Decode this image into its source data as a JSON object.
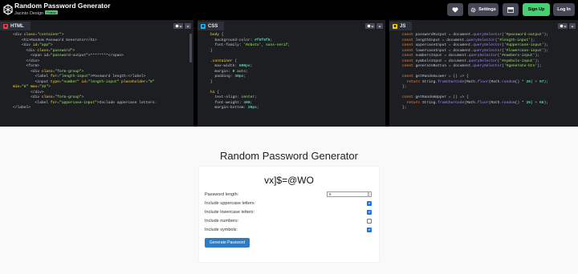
{
  "header": {
    "title": "Random Password Generator",
    "author": "Jacinto Design",
    "author_badge": "Follow",
    "settings_label": "Settings",
    "signup_label": "Sign Up",
    "login_label": "Log In"
  },
  "panels": {
    "html": {
      "label": "HTML"
    },
    "css": {
      "label": "CSS"
    },
    "js": {
      "label": "JS"
    }
  },
  "colors": {
    "accent_green": "#47cf73",
    "html_icon": "#ff3c41",
    "css_icon": "#0ebeff",
    "js_icon": "#fcd000",
    "button_blue": "#2f7bbf",
    "checkbox_blue": "#1a73e8"
  },
  "icons": {
    "logo": "codepen-logo-icon",
    "heart": "heart-icon",
    "settings": "gear-icon",
    "layout": "layout-icon",
    "chevron": "chevron-down-icon"
  },
  "result": {
    "title": "Random Password Generator",
    "password": "vx]$=@WO",
    "length_label": "Password length:",
    "length_value": "8",
    "options": [
      {
        "label": "Include uppercase letters:",
        "checked": true
      },
      {
        "label": "Include lowercase letters:",
        "checked": true
      },
      {
        "label": "Include numbers:",
        "checked": false
      },
      {
        "label": "Include symbols:",
        "checked": true
      }
    ],
    "generate_label": "Generate Password"
  }
}
